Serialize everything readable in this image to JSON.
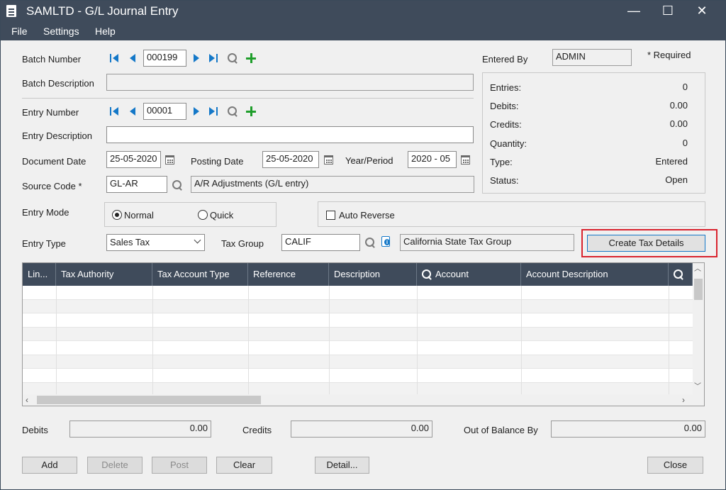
{
  "window": {
    "title": "SAMLTD - G/L Journal Entry",
    "minimize": "—",
    "maximize": "☐",
    "close": "✕"
  },
  "menu": {
    "file": "File",
    "settings": "Settings",
    "help": "Help"
  },
  "form": {
    "batch_number_label": "Batch Number",
    "batch_number": "000199",
    "batch_description_label": "Batch Description",
    "batch_description": "",
    "entry_number_label": "Entry Number",
    "entry_number": "00001",
    "entry_description_label": "Entry Description",
    "entry_description": "",
    "document_date_label": "Document Date",
    "document_date": "25-05-2020",
    "posting_date_label": "Posting Date",
    "posting_date": "25-05-2020",
    "year_period_label": "Year/Period",
    "year_period": "2020 - 05",
    "source_code_label": "Source Code *",
    "source_code": "GL-AR",
    "source_code_description": "A/R Adjustments (G/L entry)",
    "entry_mode_label": "Entry Mode",
    "mode_normal": "Normal",
    "mode_quick": "Quick",
    "auto_reverse_label": "Auto Reverse",
    "entry_type_label": "Entry Type",
    "entry_type": "Sales Tax",
    "tax_group_label": "Tax Group",
    "tax_group": "CALIF",
    "tax_group_description": "California State Tax Group",
    "create_tax_details": "Create Tax Details"
  },
  "summary": {
    "entered_by_label": "Entered By",
    "entered_by": "ADMIN",
    "required_note": "* Required",
    "entries_label": "Entries:",
    "entries": "0",
    "debits_label": "Debits:",
    "debits": "0.00",
    "credits_label": "Credits:",
    "credits": "0.00",
    "quantity_label": "Quantity:",
    "quantity": "0",
    "type_label": "Type:",
    "type": "Entered",
    "status_label": "Status:",
    "status": "Open"
  },
  "grid": {
    "columns": [
      "Lin...",
      "Tax Authority",
      "Tax Account Type",
      "Reference",
      "Description",
      "Account",
      "Account Description",
      ""
    ]
  },
  "totals": {
    "debits_label": "Debits",
    "debits": "0.00",
    "credits_label": "Credits",
    "credits": "0.00",
    "out_of_balance_label": "Out of Balance By",
    "out_of_balance": "0.00"
  },
  "buttons": {
    "add": "Add",
    "delete": "Delete",
    "post": "Post",
    "clear": "Clear",
    "detail": "Detail...",
    "close": "Close"
  },
  "colors": {
    "titlebar": "#3f4b5b",
    "accent": "#1478c8",
    "add_green": "#1f9e2b",
    "highlight_red": "#d9232e"
  }
}
